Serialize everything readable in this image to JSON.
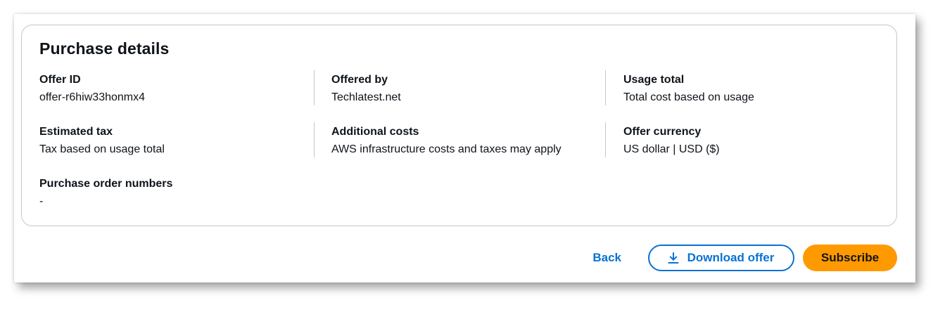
{
  "purchase_details": {
    "title": "Purchase details",
    "fields": {
      "offer_id": {
        "label": "Offer ID",
        "value": "offer-r6hiw33honmx4"
      },
      "offered_by": {
        "label": "Offered by",
        "value": "Techlatest.net"
      },
      "usage_total": {
        "label": "Usage total",
        "value": "Total cost based on usage"
      },
      "estimated_tax": {
        "label": "Estimated tax",
        "value": "Tax based on usage total"
      },
      "additional_costs": {
        "label": "Additional costs",
        "value": "AWS infrastructure costs and taxes may apply"
      },
      "offer_currency": {
        "label": "Offer currency",
        "value": "US dollar | USD ($)"
      },
      "purchase_order_numbers": {
        "label": "Purchase order numbers",
        "value": "-"
      }
    }
  },
  "actions": {
    "back_label": "Back",
    "download_label": "Download offer",
    "download_icon": "download-icon",
    "subscribe_label": "Subscribe"
  },
  "colors": {
    "link_blue": "#0972d3",
    "primary_orange": "#ff9900",
    "border_gray": "#c6c6cd",
    "text_dark": "#0f141a"
  }
}
